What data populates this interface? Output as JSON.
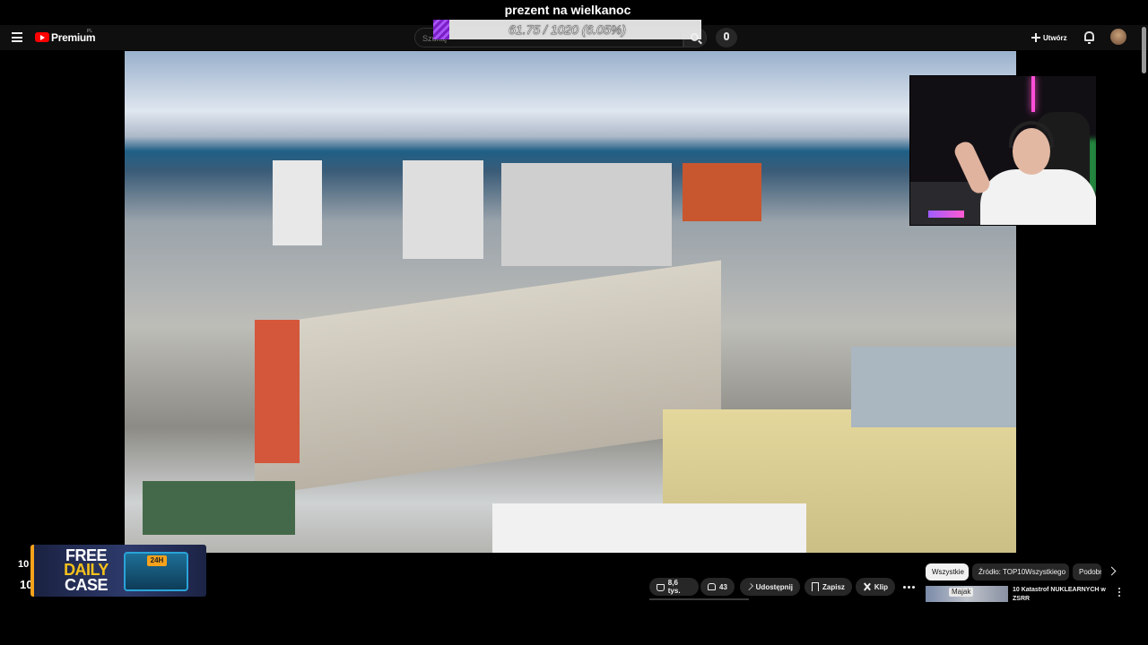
{
  "overlay": {
    "title": "prezent na wielkanoc",
    "goal_text": "61.75 / 1020 (6.05%)",
    "goal_current": 61.75,
    "goal_target": 1020,
    "goal_fraction": 0.0605,
    "goal_color": "#7b1fc7"
  },
  "topbar": {
    "brand": "Premium",
    "brand_region": "PL",
    "search_placeholder": "Szukaj",
    "create_label": "Utwórz",
    "icons": [
      "menu-icon",
      "youtube-logo-icon",
      "search-icon",
      "mic-icon",
      "plus-icon",
      "bell-icon",
      "avatar"
    ]
  },
  "left_widget": {
    "top_number": "10",
    "bottom_number": "10",
    "ad_line1": "FREE",
    "ad_line2": "DAILY",
    "ad_line3": "CASE",
    "ad_badge": "24H"
  },
  "actions": {
    "likes": "8,6 tys.",
    "dislikes": "43",
    "share": "Udostępnij",
    "save": "Zapisz",
    "clip": "Klip"
  },
  "chips": [
    {
      "label": "Wszystkie",
      "active": true
    },
    {
      "label": "Źródło: TOP10Wszystkiego",
      "active": false
    },
    {
      "label": "Podobne",
      "active": false
    }
  ],
  "recommendation": {
    "badge": "Majak",
    "title": "10 Katastrof NUKLEARNYCH w ZSRR"
  },
  "colors": {
    "background": "#0f0f0f",
    "accent_red": "#ff0000",
    "chip_active": "#f1f1f1"
  }
}
